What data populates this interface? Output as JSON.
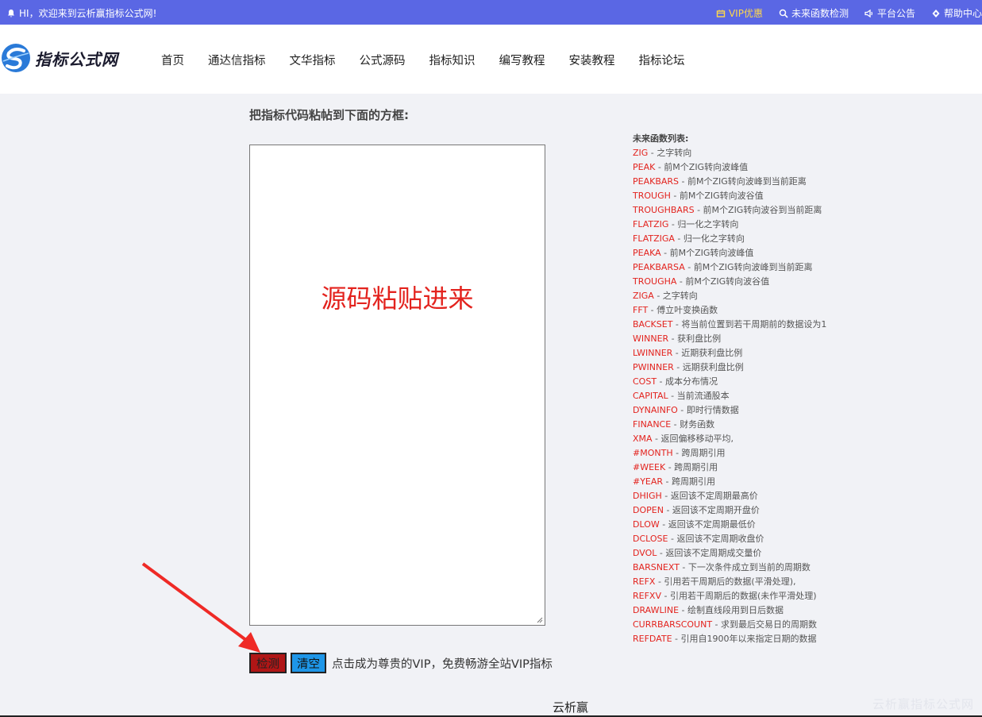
{
  "topbar": {
    "welcome": "HI，欢迎来到云析赢指标公式网!",
    "vip": "VIP优惠",
    "future_check": "未来函数检测",
    "announcement": "平台公告",
    "help": "帮助中心"
  },
  "logo": {
    "text": "指标公式网"
  },
  "nav": [
    "首页",
    "通达信指标",
    "文华指标",
    "公式源码",
    "指标知识",
    "编写教程",
    "安装教程",
    "指标论坛"
  ],
  "main": {
    "heading": "把指标代码粘帖到下面的方框:",
    "editor_placeholder": "源码粘贴进来"
  },
  "funcs": {
    "title": "未来函数列表:",
    "items": [
      {
        "name": "ZIG",
        "desc": " - 之字转向"
      },
      {
        "name": "PEAK",
        "desc": " - 前M个ZIG转向波峰值"
      },
      {
        "name": "PEAKBARS",
        "desc": " - 前M个ZIG转向波峰到当前距离"
      },
      {
        "name": "TROUGH",
        "desc": " - 前M个ZIG转向波谷值"
      },
      {
        "name": "TROUGHBARS",
        "desc": " - 前M个ZIG转向波谷到当前距离"
      },
      {
        "name": "FLATZIG",
        "desc": " - 归一化之字转向"
      },
      {
        "name": "FLATZIGA",
        "desc": " - 归一化之字转向"
      },
      {
        "name": "PEAKA",
        "desc": " - 前M个ZIG转向波峰值"
      },
      {
        "name": "PEAKBARSA",
        "desc": " - 前M个ZIG转向波峰到当前距离"
      },
      {
        "name": "TROUGHA",
        "desc": " - 前M个ZIG转向波谷值"
      },
      {
        "name": "ZIGA",
        "desc": " - 之字转向"
      },
      {
        "name": "FFT",
        "desc": " - 傅立叶变换函数"
      },
      {
        "name": "BACKSET",
        "desc": " - 将当前位置到若干周期前的数据设为1"
      },
      {
        "name": "WINNER",
        "desc": " - 获利盘比例"
      },
      {
        "name": "LWINNER",
        "desc": " - 近期获利盘比例"
      },
      {
        "name": "PWINNER",
        "desc": " - 远期获利盘比例"
      },
      {
        "name": "COST",
        "desc": " - 成本分布情况"
      },
      {
        "name": "CAPITAL",
        "desc": " - 当前流通股本"
      },
      {
        "name": "DYNAINFO",
        "desc": " - 即时行情数据"
      },
      {
        "name": "FINANCE",
        "desc": " - 财务函数"
      },
      {
        "name": "XMA",
        "desc": " - 返回偏移移动平均,"
      },
      {
        "name": "#MONTH",
        "desc": " - 跨周期引用"
      },
      {
        "name": "#WEEK",
        "desc": " - 跨周期引用"
      },
      {
        "name": "#YEAR",
        "desc": " - 跨周期引用"
      },
      {
        "name": "DHIGH",
        "desc": " - 返回该不定周期最高价"
      },
      {
        "name": "DOPEN",
        "desc": " - 返回该不定周期开盘价"
      },
      {
        "name": "DLOW",
        "desc": " - 返回该不定周期最低价"
      },
      {
        "name": "DCLOSE",
        "desc": " - 返回该不定周期收盘价"
      },
      {
        "name": "DVOL",
        "desc": " - 返回该不定周期成交量价"
      },
      {
        "name": "BARSNEXT",
        "desc": " - 下一次条件成立到当前的周期数"
      },
      {
        "name": "REFX",
        "desc": " - 引用若干周期后的数据(平滑处理),"
      },
      {
        "name": "REFXV",
        "desc": " - 引用若干周期后的数据(未作平滑处理)"
      },
      {
        "name": "DRAWLINE",
        "desc": " - 绘制直线段用到日后数据"
      },
      {
        "name": "CURRBARSCOUNT",
        "desc": " - 求到最后交易日的周期数"
      },
      {
        "name": "REFDATE",
        "desc": " - 引用自1900年以来指定日期的数据"
      }
    ]
  },
  "actions": {
    "check": "检测",
    "clear": "清空",
    "promo": "点击成为尊贵的VIP，免费畅游全站VIP指标"
  },
  "footer": {
    "text": "云析赢",
    "watermark": "云析赢指标公式网"
  }
}
